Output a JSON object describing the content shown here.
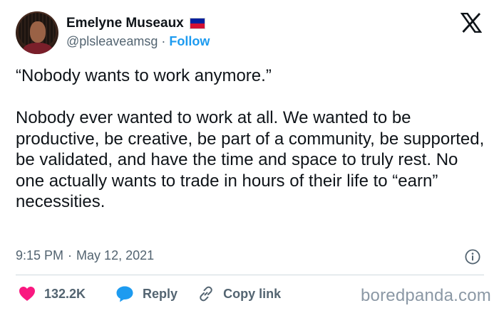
{
  "author": {
    "name": "Emelyne Museaux",
    "handle": "@plsleaveamsg",
    "separator": "·",
    "follow_label": "Follow",
    "flag_icon": "haiti-flag-icon"
  },
  "tweet": {
    "quote": "“Nobody wants to work anymore.”",
    "body": "Nobody ever wanted to work at all. We wanted to be productive, be creative, be part of a community, be supported, be validated, and have the time and space to truly rest. No one actually wants to trade in hours of their life to “earn” necessities."
  },
  "meta": {
    "time": "9:15 PM",
    "separator": "·",
    "date": "May 12, 2021"
  },
  "actions": {
    "likes": "132.2K",
    "reply_label": "Reply",
    "copy_link_label": "Copy link"
  },
  "watermark": "boredpanda.com",
  "colors": {
    "accent": "#1d9bf0",
    "like": "#f91880",
    "text": "#0f1419",
    "muted": "#536471"
  }
}
